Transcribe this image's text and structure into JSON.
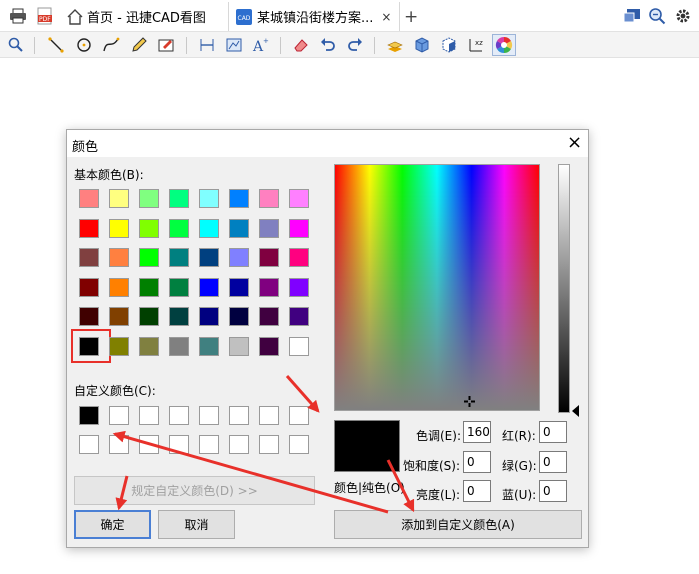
{
  "tabs": [
    {
      "label": "首页 - 迅捷CAD看图"
    },
    {
      "label": "某城镇沿街楼方案...",
      "close": "×"
    }
  ],
  "new_tab": "+",
  "dialog": {
    "title": "颜色",
    "close": "×",
    "basic_label": "基本颜色(B):",
    "basic_colors": [
      [
        "#ff8080",
        "#ffff80",
        "#80ff80",
        "#00ff80",
        "#80ffff",
        "#0080ff",
        "#ff80c0",
        "#ff80ff"
      ],
      [
        "#ff0000",
        "#ffff00",
        "#80ff00",
        "#00ff40",
        "#00ffff",
        "#0080c0",
        "#8080c0",
        "#ff00ff"
      ],
      [
        "#804040",
        "#ff8040",
        "#00ff00",
        "#008080",
        "#004080",
        "#8080ff",
        "#800040",
        "#ff0080"
      ],
      [
        "#800000",
        "#ff8000",
        "#008000",
        "#008040",
        "#0000ff",
        "#0000a0",
        "#800080",
        "#8000ff"
      ],
      [
        "#400000",
        "#804000",
        "#004000",
        "#004040",
        "#000080",
        "#000040",
        "#400040",
        "#400080"
      ],
      [
        "#000000",
        "#808000",
        "#808040",
        "#808080",
        "#408080",
        "#c0c0c0",
        "#400040",
        "#ffffff"
      ]
    ],
    "custom_label": "自定义颜色(C):",
    "custom_first": "#000000",
    "define_custom": "规定自定义颜色(D) >>",
    "ok": "确定",
    "cancel": "取消",
    "color_solid": "颜色|纯色(O)",
    "add_custom": "添加到自定义颜色(A)",
    "hue_label": "色调(E):",
    "hue": "160",
    "sat_label": "饱和度(S):",
    "sat": "0",
    "lum_label": "亮度(L):",
    "lum": "0",
    "red_label": "红(R):",
    "red": "0",
    "green_label": "绿(G):",
    "green": "0",
    "blue_label": "蓝(U):",
    "blue": "0",
    "preview_color": "#000000"
  },
  "colors": {
    "annotation_red": "#e8302a",
    "selected_border": "#e8302a"
  }
}
